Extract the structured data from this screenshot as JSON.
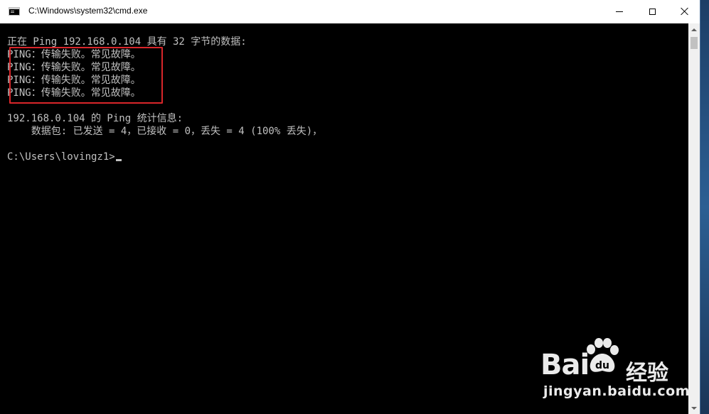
{
  "window": {
    "title": "C:\\Windows\\system32\\cmd.exe",
    "icon": "console-icon"
  },
  "controls": {
    "minimize": "minimize-icon",
    "maximize": "maximize-icon",
    "close": "close-icon"
  },
  "console": {
    "lines": [
      "",
      "正在 Ping 192.168.0.104 具有 32 字节的数据:",
      "PING：传输失败。常见故障。",
      "PING：传输失败。常见故障。",
      "PING：传输失败。常见故障。",
      "PING：传输失败。常见故障。",
      "",
      "192.168.0.104 的 Ping 统计信息:",
      "    数据包: 已发送 = 4，已接收 = 0，丢失 = 4 (100% 丢失)，",
      "",
      "C:\\Users\\lovingz1>"
    ]
  },
  "watermark": {
    "brand": "Bai du",
    "product": "经验",
    "url": "jingyan.baidu.com"
  },
  "colors": {
    "console_bg": "#000000",
    "console_fg": "#c0c0c0",
    "highlight": "#d9262a",
    "titlebar": "#ffffff"
  }
}
